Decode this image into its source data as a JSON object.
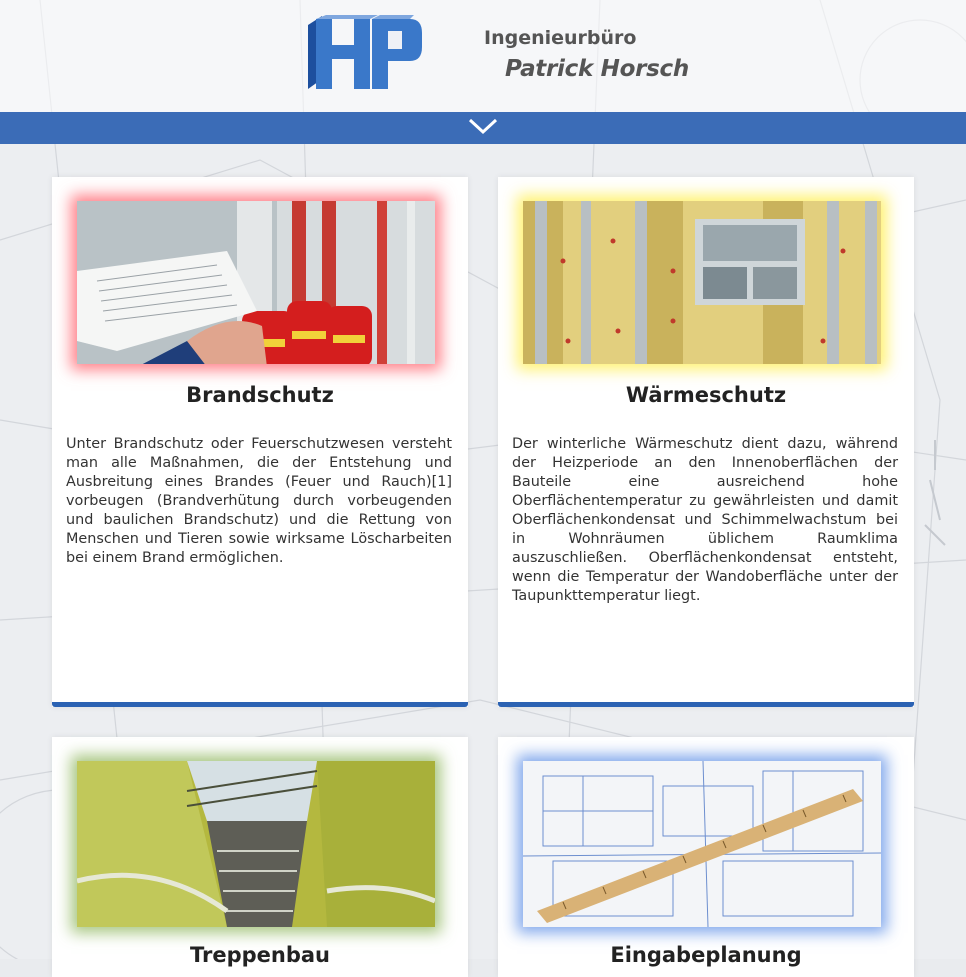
{
  "header": {
    "logo_letters": "HP",
    "company_line1": "Ingenieurbüro",
    "company_line2": "Patrick Horsch"
  },
  "nav": {
    "toggle_icon": "chevron-down-icon"
  },
  "cards": [
    {
      "title": "Brandschutz",
      "text": "Unter Brandschutz oder Feuerschutzwesen versteht man alle Maßnahmen, die der Entstehung und Ausbreitung eines Brandes (Feuer und Rauch)[1] vorbeugen (Brandverhütung durch vorbeugenden und baulichen Brandschutz) und die Rettung von Menschen und Tieren sowie wirksame Löscharbeiten bei einem Brand ermöglichen."
    },
    {
      "title": "Wärmeschutz",
      "text": "Der winterliche Wärmeschutz dient dazu, während der Heizperiode an den Innenoberflächen der Bauteile eine ausreichend hohe Oberflächentemperatur zu gewährleisten und damit Oberflächenkondensat und Schimmelwachstum bei in Wohnräumen üblichem Raumklima auszuschließen. Oberflächenkondensat entsteht, wenn die Temperatur der Wandoberfläche unter der Taupunkttemperatur liegt."
    },
    {
      "title": "Treppenbau",
      "text": ""
    },
    {
      "title": "Eingabeplanung",
      "text": ""
    }
  ],
  "colors": {
    "nav": "#3b6cb7",
    "logo": "#2b62b3",
    "card_bar": "#2b62b3"
  }
}
